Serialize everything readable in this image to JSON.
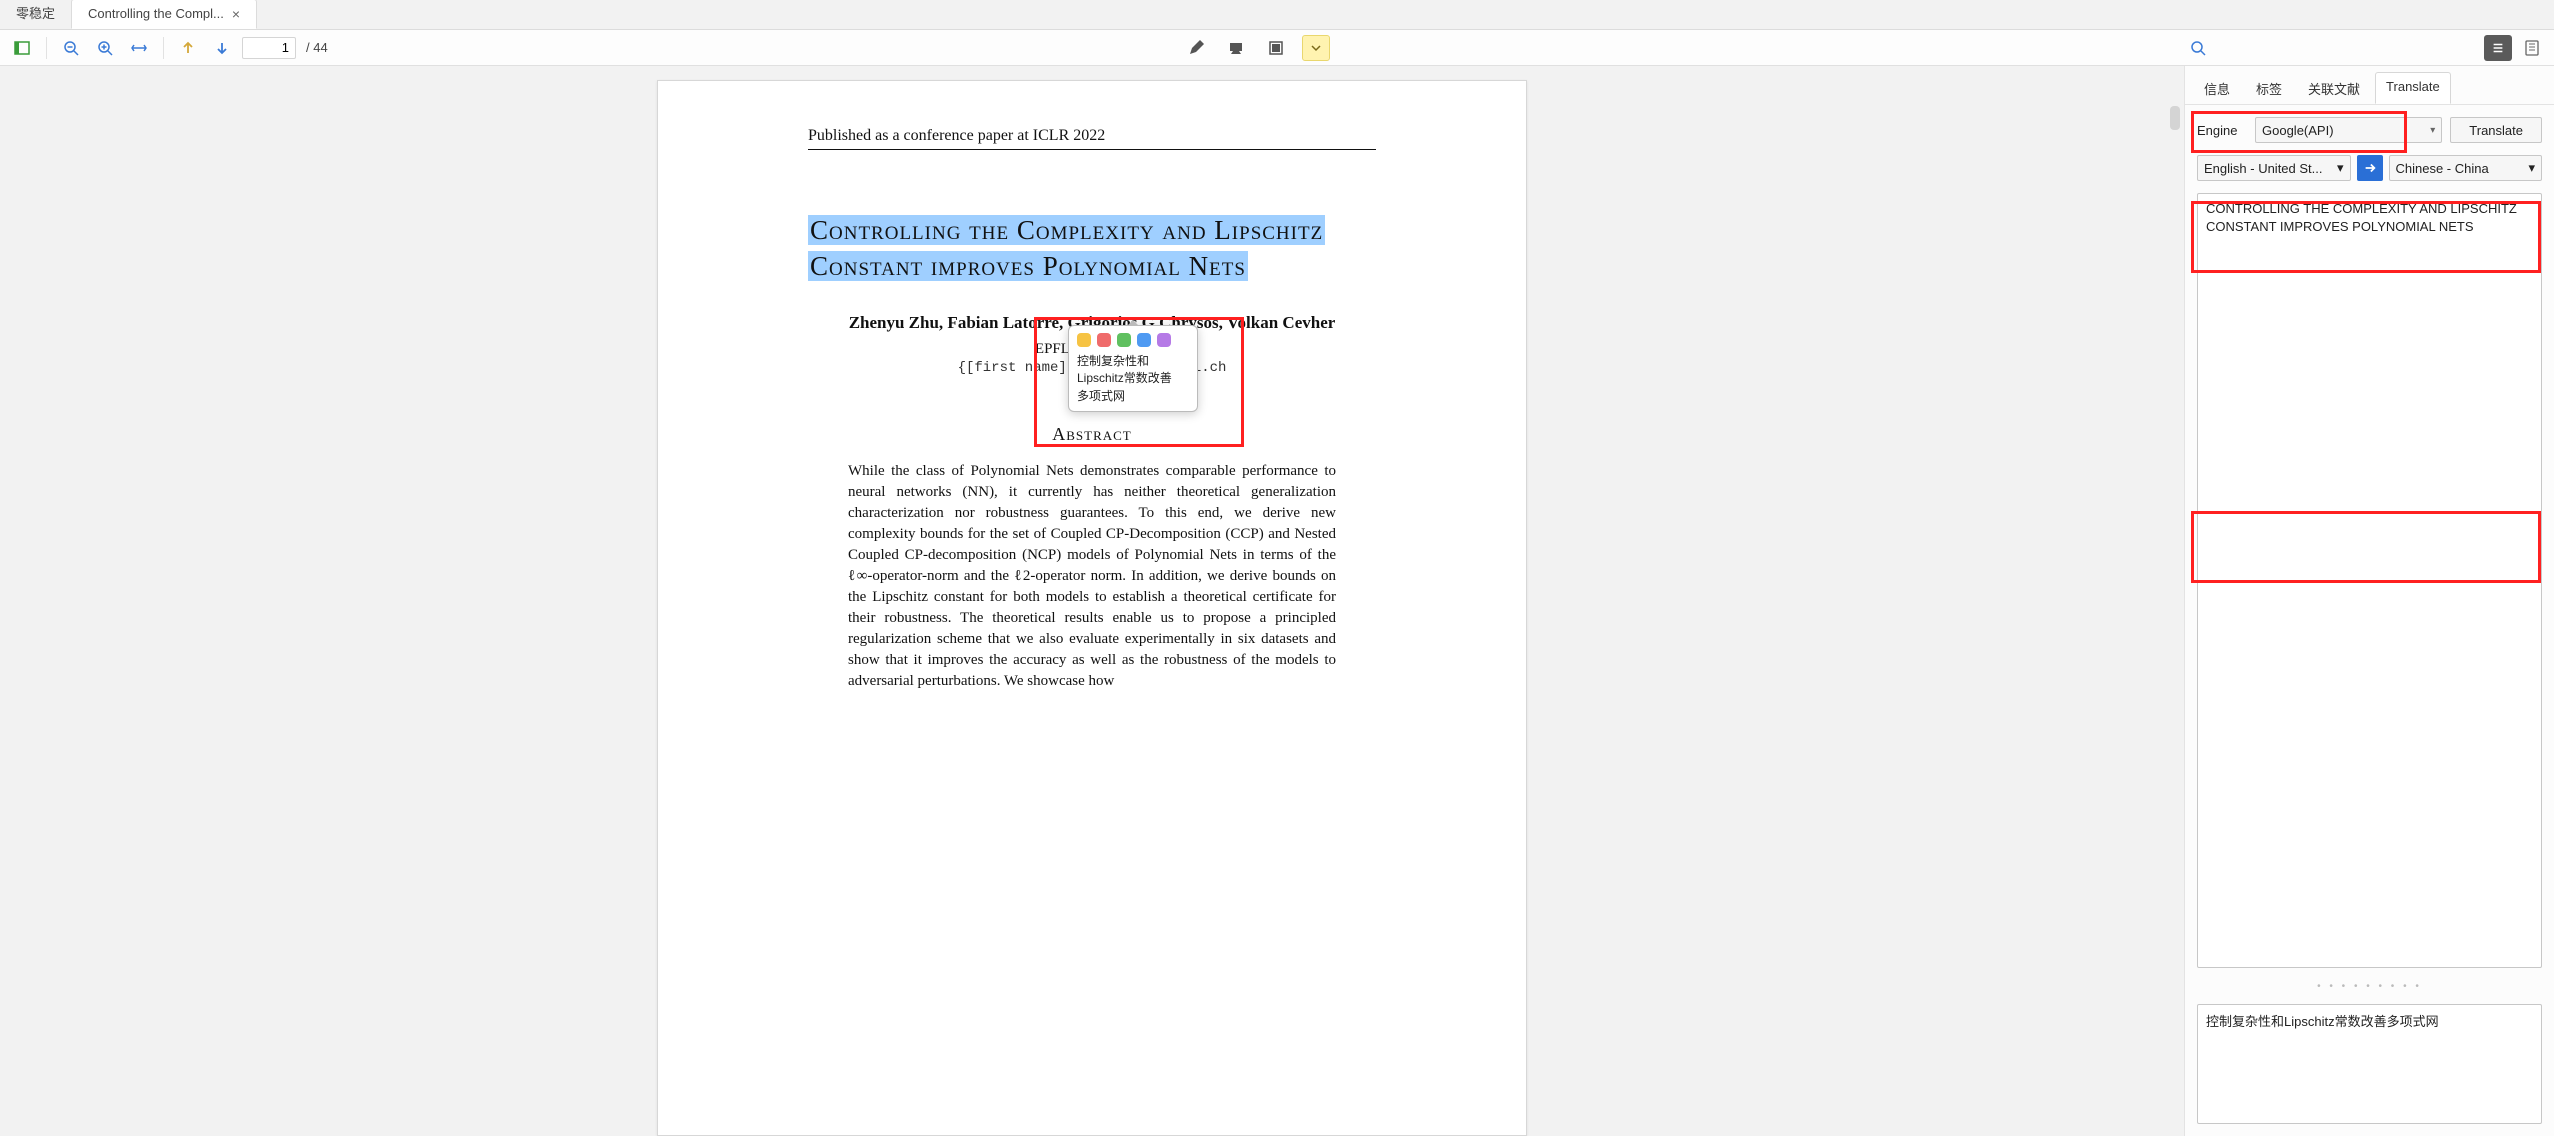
{
  "tabs": {
    "inactive": "零稳定",
    "active": "Controlling the Compl..."
  },
  "toolbar": {
    "page_current": "1",
    "page_total": "/ 44"
  },
  "paper": {
    "conf": "Published as a conference paper at ICLR 2022",
    "title_line1": "Controlling  the  Complexity  and  Lipschitz",
    "title_line2": "Constant improves Polynomial Nets",
    "authors": "Zhenyu Zhu,    Fabian Latorre,    Grigorios G Chrysos,    Volkan Cevher",
    "affil": "EPFL, Switzerland",
    "email": "{[first name].[surname]}@epfl.ch",
    "abstract_head": "Abstract",
    "abstract": "While the class of Polynomial Nets demonstrates comparable performance to neural networks (NN), it currently has neither theoretical generalization characterization nor robustness guarantees. To this end, we derive new complexity bounds for the set of Coupled CP-Decomposition (CCP) and Nested Coupled CP-decomposition (NCP) models of Polynomial Nets in terms of the ℓ∞-operator-norm and the ℓ2-operator norm. In addition, we derive bounds on the Lipschitz constant for both models to establish a theoretical certificate for their robustness. The theoretical results enable us to propose a principled regularization scheme that we also evaluate experimentally in six datasets and show that it improves the accuracy as well as the robustness of the models to adversarial perturbations. We showcase how"
  },
  "popup": {
    "colors": [
      "#f6c343",
      "#ef6b6b",
      "#60c060",
      "#4f9af2",
      "#b57ae6"
    ],
    "line1": "控制复杂性和",
    "line2": "Lipschitz常数改善",
    "line3": "多项式网"
  },
  "side": {
    "tabs": {
      "info": "信息",
      "tags": "标签",
      "related": "关联文献",
      "translate": "Translate"
    },
    "engine_label": "Engine",
    "engine_value": "Google(API)",
    "translate_btn": "Translate",
    "lang_from": "English - United St...",
    "lang_to": "Chinese - China",
    "source_text": "CONTROLLING THE COMPLEXITY AND LIPSCHITZ CONSTANT IMPROVES POLYNOMIAL NETS",
    "target_text": "控制复杂性和Lipschitz常数改善多项式网"
  }
}
